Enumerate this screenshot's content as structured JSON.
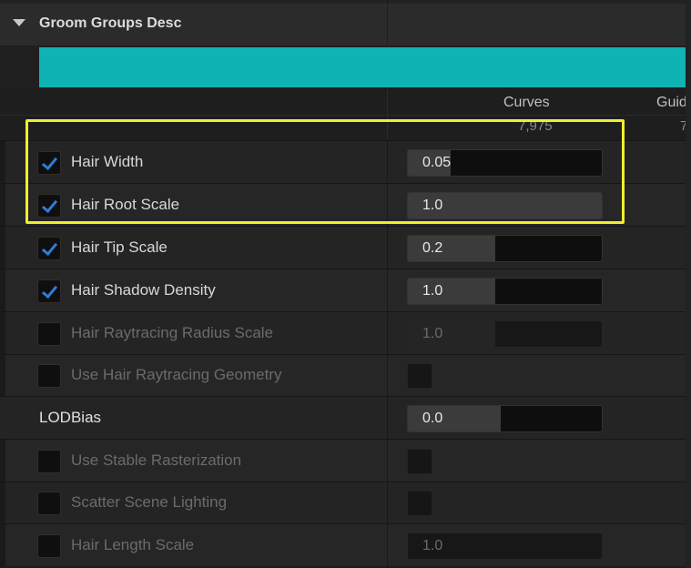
{
  "section": {
    "title": "Groom Groups Desc",
    "accent_color": "#0fb3b3"
  },
  "columns": {
    "curves_label": "Curves",
    "curves_count": "7,975",
    "guides_label": "Guid",
    "guides_count": "7"
  },
  "properties": [
    {
      "label": "Hair Width",
      "checked": true,
      "enabled": true,
      "value": "0.05",
      "fill": 0.22
    },
    {
      "label": "Hair Root Scale",
      "checked": true,
      "enabled": true,
      "value": "1.0",
      "fill": 1.0
    },
    {
      "label": "Hair Tip Scale",
      "checked": true,
      "enabled": true,
      "value": "0.2",
      "fill": 0.45
    },
    {
      "label": "Hair Shadow Density",
      "checked": true,
      "enabled": true,
      "value": "1.0",
      "fill": 0.45
    },
    {
      "label": "Hair Raytracing Radius Scale",
      "checked": false,
      "enabled": false,
      "value": "1.0",
      "fill": 0.45
    },
    {
      "label": "Use Hair Raytracing Geometry",
      "checked": false,
      "enabled": false,
      "value": null
    },
    {
      "label": "LODBias",
      "checked": null,
      "enabled": true,
      "value": "0.0",
      "fill": 0.48
    },
    {
      "label": "Use Stable Rasterization",
      "checked": false,
      "enabled": false,
      "value": null
    },
    {
      "label": "Scatter Scene Lighting",
      "checked": false,
      "enabled": false,
      "value": null
    },
    {
      "label": "Hair Length Scale",
      "checked": false,
      "enabled": false,
      "value": "1.0",
      "fill": 0.0
    }
  ],
  "highlight_color": "#f2ee2c",
  "checkbox_tick_color": "#2f7dd8"
}
